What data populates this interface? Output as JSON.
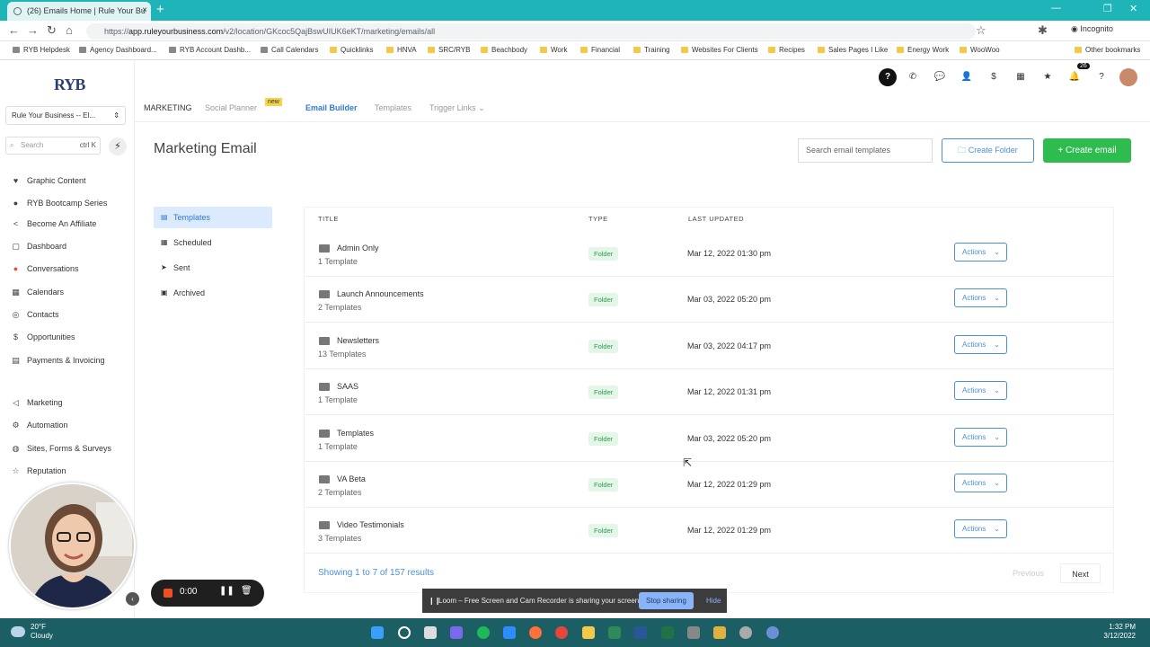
{
  "browser": {
    "tab_title": "(26) Emails Home | Rule Your Bu",
    "url_prefix": "https://",
    "url_host": "app.ruleyourbusiness.com",
    "url_path": "/v2/location/GKcoc5QajBswUIUK6eKT/marketing/emails/all",
    "incognito_label": "Incognito",
    "bookmarks": [
      "RYB Helpdesk",
      "Agency Dashboard...",
      "RYB Account Dashb...",
      "Call Calendars",
      "Quicklinks",
      "HNVA",
      "SRC/RYB",
      "Beachbody",
      "Work",
      "Financial",
      "Training",
      "Websites For Clients",
      "Recipes",
      "Sales Pages I Like",
      "Energy Work",
      "WooWoo"
    ],
    "other_bookmarks": "Other bookmarks"
  },
  "sidebar": {
    "logo": "RYB",
    "account": "Rule Your Business -- El...",
    "search_placeholder": "Search",
    "search_shortcut": "ctrl K",
    "items": [
      {
        "label": "Graphic Content",
        "icon": "heart-icon"
      },
      {
        "label": "RYB Bootcamp Series",
        "icon": "dot-icon"
      },
      {
        "label": "Become An Affiliate",
        "icon": "share-icon"
      },
      {
        "label": "Dashboard",
        "icon": "dashboard-icon"
      },
      {
        "label": "Conversations",
        "icon": "chat-icon"
      },
      {
        "label": "Calendars",
        "icon": "calendar-icon"
      },
      {
        "label": "Contacts",
        "icon": "contacts-icon"
      },
      {
        "label": "Opportunities",
        "icon": "dollar-icon"
      },
      {
        "label": "Payments & Invoicing",
        "icon": "invoice-icon"
      },
      {
        "label": "Marketing",
        "icon": "megaphone-icon"
      },
      {
        "label": "Automation",
        "icon": "automation-icon"
      },
      {
        "label": "Sites, Forms & Surveys",
        "icon": "globe-icon"
      },
      {
        "label": "Reputation",
        "icon": "star-icon"
      }
    ]
  },
  "topbar": {
    "notification_count": "26"
  },
  "subnav": {
    "section": "MARKETING",
    "social_planner": "Social Planner",
    "new_badge": "new",
    "email_builder": "Email Builder",
    "templates": "Templates",
    "trigger_links": "Trigger Links"
  },
  "page": {
    "title": "Marketing Email",
    "search_placeholder": "Search email templates",
    "create_folder": "Create Folder",
    "create_email": "Create email"
  },
  "left_nav": [
    {
      "label": "Templates",
      "icon": "template-icon"
    },
    {
      "label": "Scheduled",
      "icon": "schedule-icon"
    },
    {
      "label": "Sent",
      "icon": "send-icon"
    },
    {
      "label": "Archived",
      "icon": "archive-icon"
    }
  ],
  "table": {
    "headers": [
      "TITLE",
      "TYPE",
      "LAST UPDATED"
    ],
    "action_label": "Actions",
    "rows": [
      {
        "name": "Admin Only",
        "count": "1 Template",
        "type": "Folder",
        "date": "Mar 12, 2022 01:30 pm"
      },
      {
        "name": "Launch Announcements",
        "count": "2 Templates",
        "type": "Folder",
        "date": "Mar 03, 2022 05:20 pm"
      },
      {
        "name": "Newsletters",
        "count": "13 Templates",
        "type": "Folder",
        "date": "Mar 03, 2022 04:17 pm"
      },
      {
        "name": "SAAS",
        "count": "1 Template",
        "type": "Folder",
        "date": "Mar 12, 2022 01:31 pm"
      },
      {
        "name": "Templates",
        "count": "1 Template",
        "type": "Folder",
        "date": "Mar 03, 2022 05:20 pm"
      },
      {
        "name": "VA Beta",
        "count": "2 Templates",
        "type": "Folder",
        "date": "Mar 12, 2022 01:29 pm"
      },
      {
        "name": "Video Testimonials",
        "count": "3 Templates",
        "type": "Folder",
        "date": "Mar 12, 2022 01:29 pm"
      }
    ],
    "showing": "Showing 1 to 7 of 157 results",
    "previous": "Previous",
    "next": "Next"
  },
  "recorder": {
    "time": "0:00",
    "loom_message": "Loom – Free Screen and Cam Recorder is sharing your screen.",
    "stop_sharing": "Stop sharing",
    "hide": "Hide"
  },
  "taskbar": {
    "temp": "20°F",
    "weather": "Cloudy",
    "time": "1:32 PM",
    "date": "3/12/2022"
  }
}
